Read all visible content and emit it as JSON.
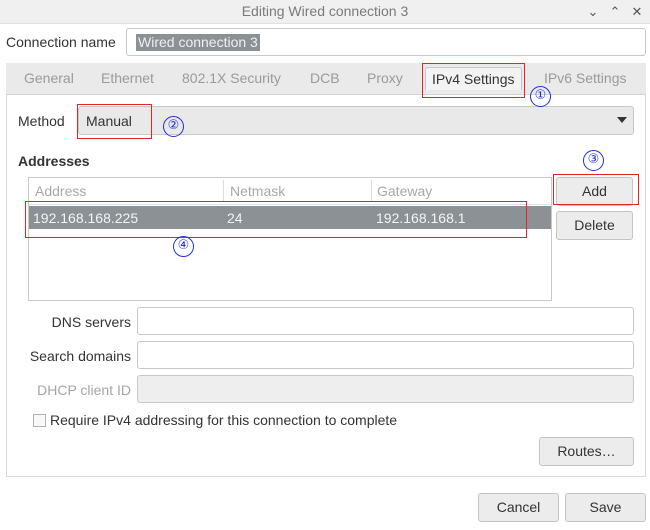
{
  "window": {
    "title": "Editing Wired connection 3",
    "minimize_icon": "chevron-down-icon",
    "maximize_icon": "chevron-up-icon",
    "close_icon": "close-icon"
  },
  "connection": {
    "label": "Connection name",
    "value": "Wired connection 3"
  },
  "tabs": [
    {
      "label": "General"
    },
    {
      "label": "Ethernet"
    },
    {
      "label": "802.1X Security"
    },
    {
      "label": "DCB"
    },
    {
      "label": "Proxy"
    },
    {
      "label": "IPv4 Settings",
      "active": true
    },
    {
      "label": "IPv6 Settings"
    }
  ],
  "method": {
    "label": "Method",
    "value": "Manual"
  },
  "addresses": {
    "heading": "Addresses",
    "columns": [
      "Address",
      "Netmask",
      "Gateway"
    ],
    "rows": [
      {
        "address": "192.168.168.225",
        "netmask": "24",
        "gateway": "192.168.168.1",
        "selected": true
      }
    ],
    "add_label": "Add",
    "delete_label": "Delete"
  },
  "fields": {
    "dns_label": "DNS servers",
    "dns_value": "",
    "search_label": "Search domains",
    "search_value": "",
    "dhcp_label": "DHCP client ID",
    "dhcp_value": ""
  },
  "require": {
    "label": "Require IPv4 addressing for this connection to complete",
    "checked": false
  },
  "buttons": {
    "routes": "Routes…",
    "cancel": "Cancel",
    "save": "Save"
  },
  "annotations": {
    "marker_1": "①",
    "marker_2": "②",
    "marker_3": "③",
    "marker_4": "④",
    "box_color": "#e8241f",
    "marker_color": "#1f2fd6"
  },
  "colors": {
    "selection": "#8c9196",
    "disabled_text": "#a4a4a4"
  }
}
